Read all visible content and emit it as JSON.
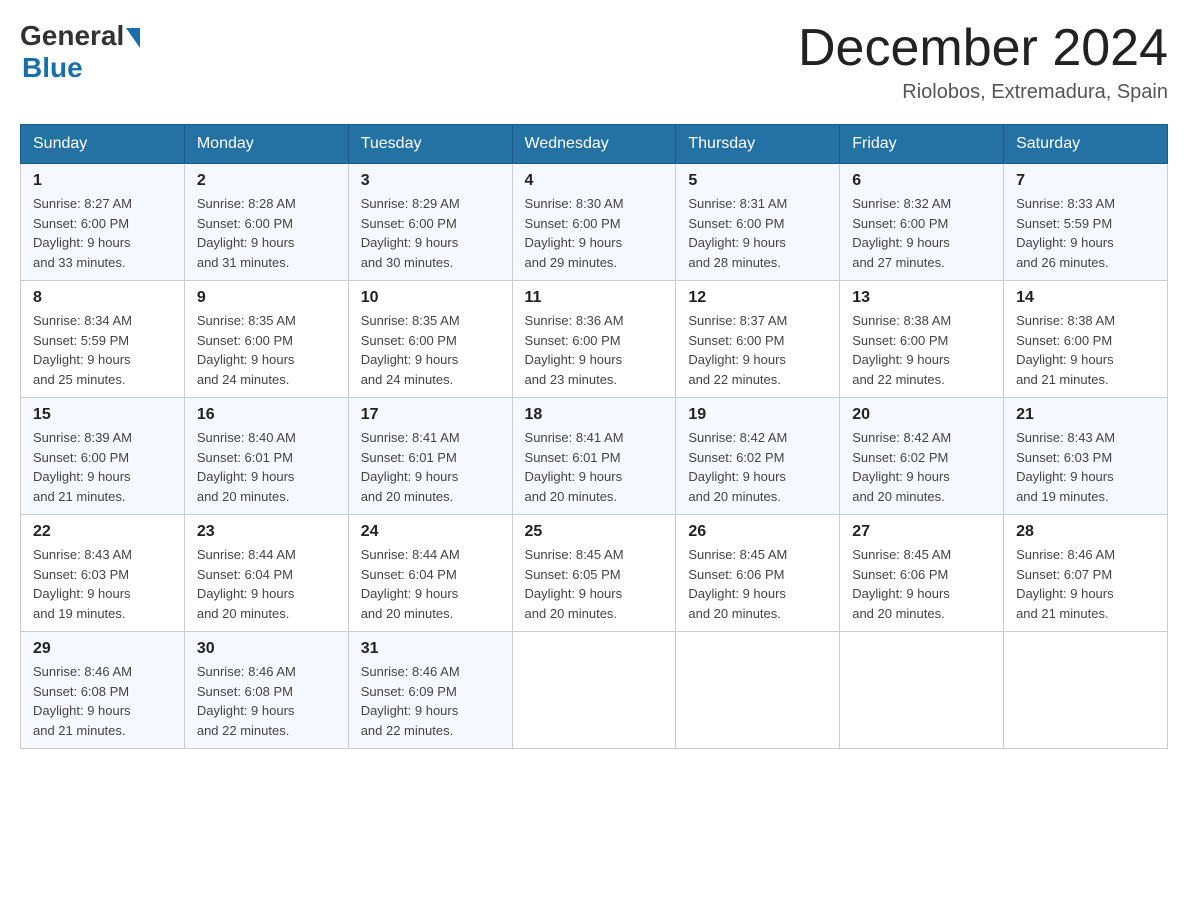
{
  "logo": {
    "general": "General",
    "blue": "Blue"
  },
  "title": "December 2024",
  "location": "Riolobos, Extremadura, Spain",
  "weekdays": [
    "Sunday",
    "Monday",
    "Tuesday",
    "Wednesday",
    "Thursday",
    "Friday",
    "Saturday"
  ],
  "weeks": [
    [
      {
        "day": "1",
        "sunrise": "8:27 AM",
        "sunset": "6:00 PM",
        "daylight": "9 hours and 33 minutes."
      },
      {
        "day": "2",
        "sunrise": "8:28 AM",
        "sunset": "6:00 PM",
        "daylight": "9 hours and 31 minutes."
      },
      {
        "day": "3",
        "sunrise": "8:29 AM",
        "sunset": "6:00 PM",
        "daylight": "9 hours and 30 minutes."
      },
      {
        "day": "4",
        "sunrise": "8:30 AM",
        "sunset": "6:00 PM",
        "daylight": "9 hours and 29 minutes."
      },
      {
        "day": "5",
        "sunrise": "8:31 AM",
        "sunset": "6:00 PM",
        "daylight": "9 hours and 28 minutes."
      },
      {
        "day": "6",
        "sunrise": "8:32 AM",
        "sunset": "6:00 PM",
        "daylight": "9 hours and 27 minutes."
      },
      {
        "day": "7",
        "sunrise": "8:33 AM",
        "sunset": "5:59 PM",
        "daylight": "9 hours and 26 minutes."
      }
    ],
    [
      {
        "day": "8",
        "sunrise": "8:34 AM",
        "sunset": "5:59 PM",
        "daylight": "9 hours and 25 minutes."
      },
      {
        "day": "9",
        "sunrise": "8:35 AM",
        "sunset": "6:00 PM",
        "daylight": "9 hours and 24 minutes."
      },
      {
        "day": "10",
        "sunrise": "8:35 AM",
        "sunset": "6:00 PM",
        "daylight": "9 hours and 24 minutes."
      },
      {
        "day": "11",
        "sunrise": "8:36 AM",
        "sunset": "6:00 PM",
        "daylight": "9 hours and 23 minutes."
      },
      {
        "day": "12",
        "sunrise": "8:37 AM",
        "sunset": "6:00 PM",
        "daylight": "9 hours and 22 minutes."
      },
      {
        "day": "13",
        "sunrise": "8:38 AM",
        "sunset": "6:00 PM",
        "daylight": "9 hours and 22 minutes."
      },
      {
        "day": "14",
        "sunrise": "8:38 AM",
        "sunset": "6:00 PM",
        "daylight": "9 hours and 21 minutes."
      }
    ],
    [
      {
        "day": "15",
        "sunrise": "8:39 AM",
        "sunset": "6:00 PM",
        "daylight": "9 hours and 21 minutes."
      },
      {
        "day": "16",
        "sunrise": "8:40 AM",
        "sunset": "6:01 PM",
        "daylight": "9 hours and 20 minutes."
      },
      {
        "day": "17",
        "sunrise": "8:41 AM",
        "sunset": "6:01 PM",
        "daylight": "9 hours and 20 minutes."
      },
      {
        "day": "18",
        "sunrise": "8:41 AM",
        "sunset": "6:01 PM",
        "daylight": "9 hours and 20 minutes."
      },
      {
        "day": "19",
        "sunrise": "8:42 AM",
        "sunset": "6:02 PM",
        "daylight": "9 hours and 20 minutes."
      },
      {
        "day": "20",
        "sunrise": "8:42 AM",
        "sunset": "6:02 PM",
        "daylight": "9 hours and 20 minutes."
      },
      {
        "day": "21",
        "sunrise": "8:43 AM",
        "sunset": "6:03 PM",
        "daylight": "9 hours and 19 minutes."
      }
    ],
    [
      {
        "day": "22",
        "sunrise": "8:43 AM",
        "sunset": "6:03 PM",
        "daylight": "9 hours and 19 minutes."
      },
      {
        "day": "23",
        "sunrise": "8:44 AM",
        "sunset": "6:04 PM",
        "daylight": "9 hours and 20 minutes."
      },
      {
        "day": "24",
        "sunrise": "8:44 AM",
        "sunset": "6:04 PM",
        "daylight": "9 hours and 20 minutes."
      },
      {
        "day": "25",
        "sunrise": "8:45 AM",
        "sunset": "6:05 PM",
        "daylight": "9 hours and 20 minutes."
      },
      {
        "day": "26",
        "sunrise": "8:45 AM",
        "sunset": "6:06 PM",
        "daylight": "9 hours and 20 minutes."
      },
      {
        "day": "27",
        "sunrise": "8:45 AM",
        "sunset": "6:06 PM",
        "daylight": "9 hours and 20 minutes."
      },
      {
        "day": "28",
        "sunrise": "8:46 AM",
        "sunset": "6:07 PM",
        "daylight": "9 hours and 21 minutes."
      }
    ],
    [
      {
        "day": "29",
        "sunrise": "8:46 AM",
        "sunset": "6:08 PM",
        "daylight": "9 hours and 21 minutes."
      },
      {
        "day": "30",
        "sunrise": "8:46 AM",
        "sunset": "6:08 PM",
        "daylight": "9 hours and 22 minutes."
      },
      {
        "day": "31",
        "sunrise": "8:46 AM",
        "sunset": "6:09 PM",
        "daylight": "9 hours and 22 minutes."
      },
      null,
      null,
      null,
      null
    ]
  ],
  "labels": {
    "sunrise": "Sunrise:",
    "sunset": "Sunset:",
    "daylight": "Daylight:"
  }
}
